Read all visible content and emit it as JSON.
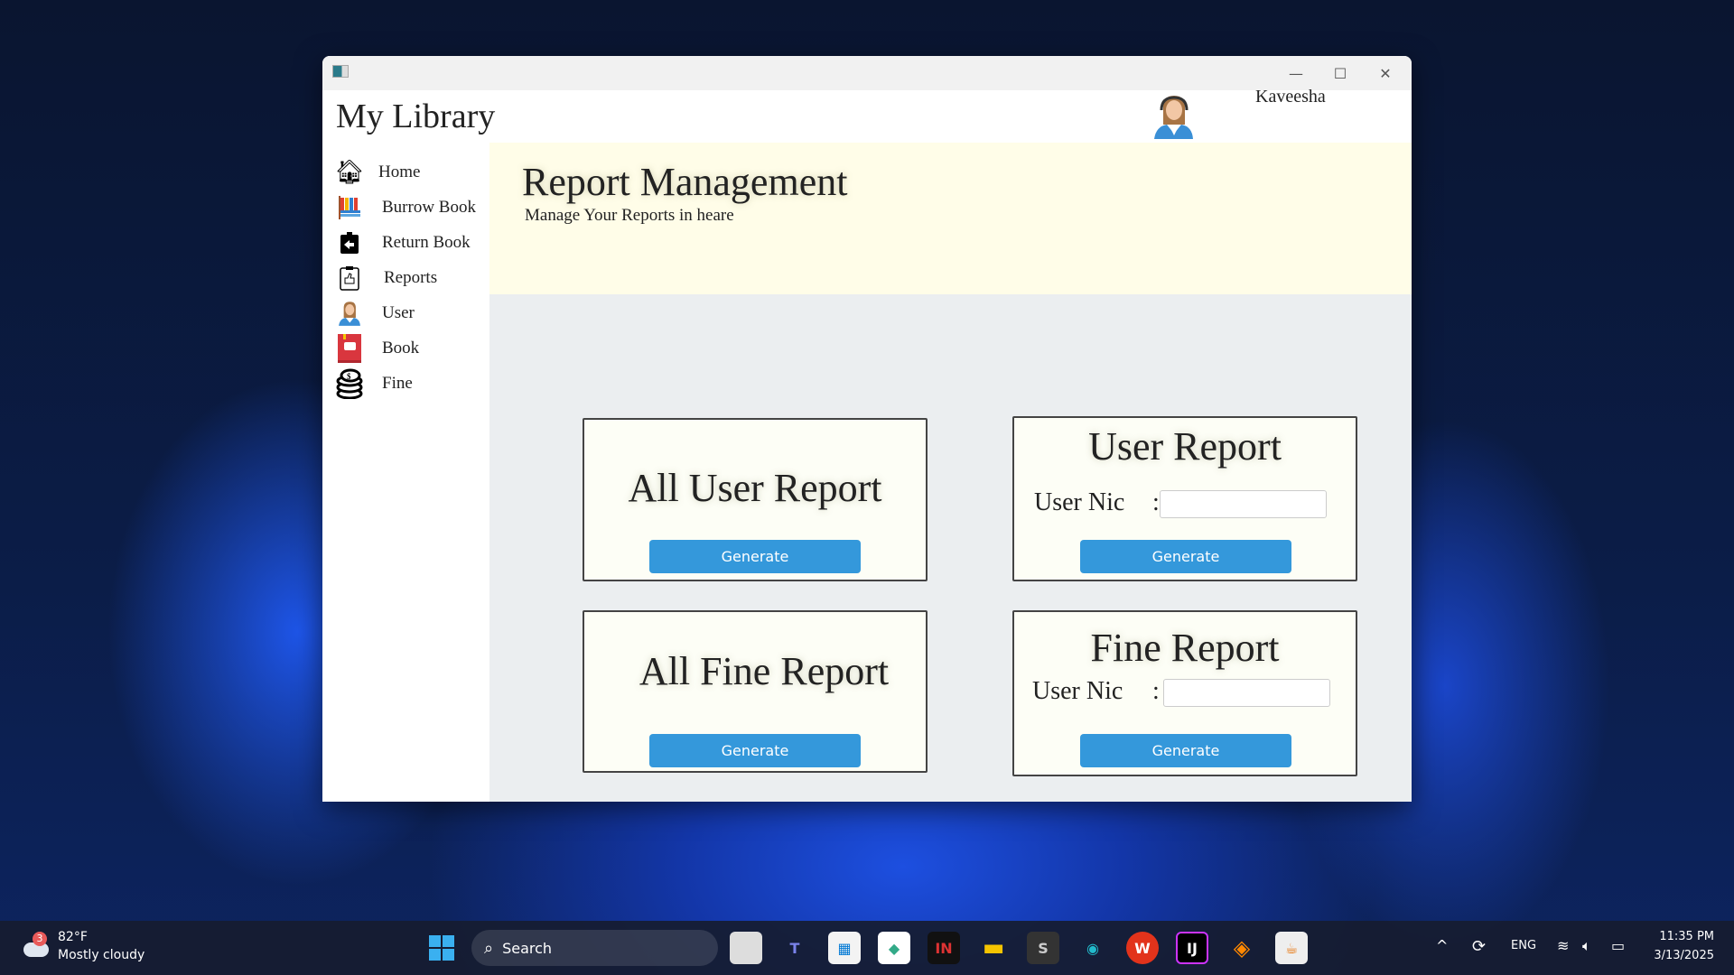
{
  "window": {
    "app_title": "My Library",
    "user_name": "Kaveesha",
    "controls": {
      "minimize": "—",
      "maximize": "☐",
      "close": "✕"
    }
  },
  "sidebar": {
    "items": [
      {
        "label": "Home",
        "icon": "home-icon"
      },
      {
        "label": "Burrow Book",
        "icon": "books-icon"
      },
      {
        "label": "Return Book",
        "icon": "return-book-icon"
      },
      {
        "label": "Reports",
        "icon": "report-clipboard-icon"
      },
      {
        "label": "User",
        "icon": "user-icon"
      },
      {
        "label": "Book",
        "icon": "book-icon"
      },
      {
        "label": "Fine",
        "icon": "coins-icon"
      }
    ]
  },
  "banner": {
    "title": "Report Management",
    "subtitle": "Manage Your Reports in heare"
  },
  "cards": {
    "all_user": {
      "title": "All User Report",
      "button": "Generate"
    },
    "user": {
      "title": "User Report",
      "field_label": "User Nic",
      "colon": ":",
      "value": "",
      "button": "Generate"
    },
    "all_fine": {
      "title": "All Fine Report",
      "button": "Generate"
    },
    "fine": {
      "title": "Fine Report",
      "field_label": "User Nic",
      "colon": ":",
      "value": "",
      "button": "Generate"
    }
  },
  "taskbar": {
    "weather_temp": "82°F",
    "weather_desc": "Mostly cloudy",
    "weather_badge": "3",
    "search": "Search",
    "lang": "ENG",
    "time": "11:35 PM",
    "date": "3/13/2025"
  },
  "colors": {
    "accent": "#3498db",
    "banner": "#fffde8",
    "content_bg": "#ebeef0"
  }
}
